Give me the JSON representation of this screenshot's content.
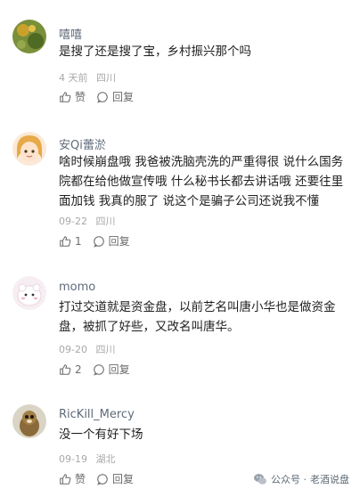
{
  "comments": [
    {
      "author": "嘻嘻",
      "text": "是搜了还是搜了宝，乡村振兴那个吗",
      "time": "4 天前",
      "location": "四川",
      "like_label": "赞",
      "like_count": "",
      "reply_label": "回复"
    },
    {
      "author": "安Qi蕾淤",
      "text": "啥时候崩盘哦 我爸被洗脑壳洗的严重得很 说什么国务院都在给他做宣传哦 什么秘书长都去讲话哦 还要往里面加钱 我真的服了 说这个是骗子公司还说我不懂",
      "time": "09-22",
      "location": "四川",
      "like_label": "",
      "like_count": "1",
      "reply_label": "回复"
    },
    {
      "author": "momo",
      "text": "打过交道就是资金盘，以前艺名叫唐小华也是做资金盘，被抓了好些，又改名叫唐华。",
      "time": "09-20",
      "location": "四川",
      "like_label": "",
      "like_count": "2",
      "reply_label": "回复"
    },
    {
      "author": "RicKill_Mercy",
      "text": "没一个有好下场",
      "time": "09-19",
      "location": "湖北",
      "like_label": "赞",
      "like_count": "",
      "reply_label": "回复"
    }
  ],
  "watermark": {
    "prefix": "公众号 ·",
    "name": "老酒说盘"
  }
}
